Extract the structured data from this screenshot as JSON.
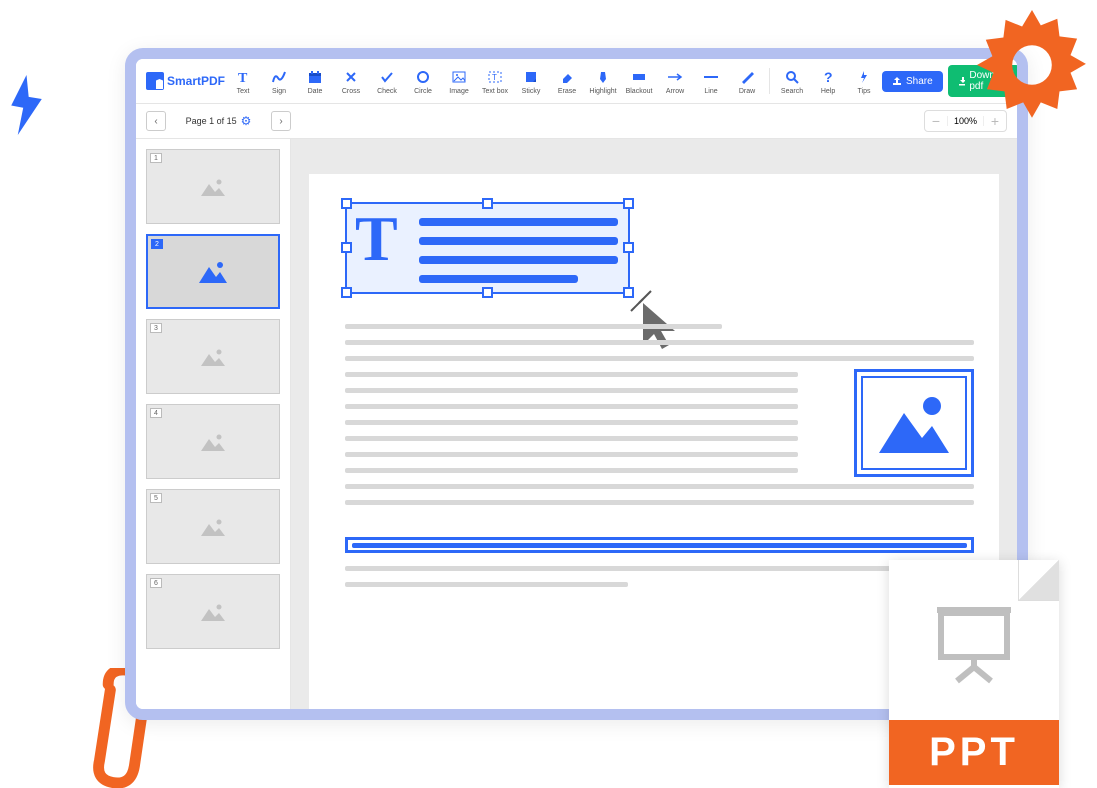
{
  "app": {
    "name": "SmartPDF"
  },
  "tools": [
    {
      "id": "text",
      "label": "Text"
    },
    {
      "id": "sign",
      "label": "Sign"
    },
    {
      "id": "date",
      "label": "Date"
    },
    {
      "id": "cross",
      "label": "Cross"
    },
    {
      "id": "check",
      "label": "Check"
    },
    {
      "id": "circle",
      "label": "Circle"
    },
    {
      "id": "image",
      "label": "Image"
    },
    {
      "id": "textbox",
      "label": "Text box"
    },
    {
      "id": "sticky",
      "label": "Sticky"
    },
    {
      "id": "erase",
      "label": "Erase"
    },
    {
      "id": "highlight",
      "label": "Highlight"
    },
    {
      "id": "blackout",
      "label": "Blackout"
    },
    {
      "id": "arrow",
      "label": "Arrow"
    },
    {
      "id": "line",
      "label": "Line"
    },
    {
      "id": "draw",
      "label": "Draw"
    }
  ],
  "util_tools": [
    {
      "id": "search",
      "label": "Search"
    },
    {
      "id": "help",
      "label": "Help"
    },
    {
      "id": "tips",
      "label": "Tips"
    }
  ],
  "actions": {
    "share": "Share",
    "download": "Download pdf"
  },
  "nav": {
    "page_indicator": "Page 1 of 15",
    "zoom": "100%"
  },
  "thumbnails": [
    {
      "n": "1",
      "selected": false
    },
    {
      "n": "2",
      "selected": true
    },
    {
      "n": "3",
      "selected": false
    },
    {
      "n": "4",
      "selected": false
    },
    {
      "n": "5",
      "selected": false
    },
    {
      "n": "6",
      "selected": false
    }
  ],
  "ppt": {
    "label": "PPT"
  },
  "colors": {
    "primary": "#2d68f8",
    "accent": "#f16522",
    "success": "#0fbd72"
  }
}
